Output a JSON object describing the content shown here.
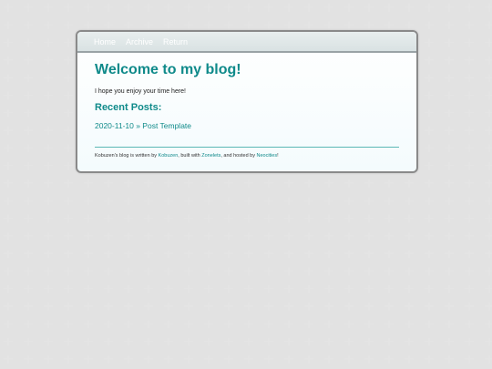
{
  "nav": {
    "items": [
      {
        "label": "Home"
      },
      {
        "label": "Archive"
      },
      {
        "label": "Return"
      }
    ]
  },
  "main": {
    "title": "Welcome to my blog!",
    "intro": "I hope you enjoy your time here!",
    "recent_heading": "Recent Posts:",
    "posts": [
      {
        "label": "2020-11-10 » Post Template"
      }
    ]
  },
  "footer": {
    "prefix": "Kobuzen's blog is written by ",
    "author": "Kobuzen",
    "mid1": ", built with ",
    "tool": "Zonelets",
    "mid2": ", and hosted by ",
    "host": "Neocities",
    "suffix": "!"
  },
  "colors": {
    "accent": "#0f8a8a",
    "background_pattern": "#e2e2e2"
  }
}
